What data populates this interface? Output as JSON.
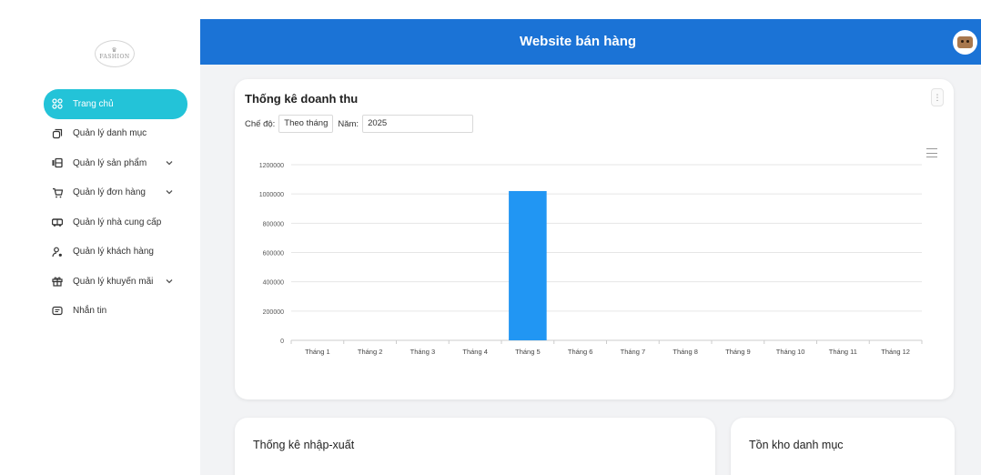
{
  "app": {
    "header_title": "Website bán hàng",
    "logo_text": "FASHION"
  },
  "sidebar": {
    "items": [
      {
        "label": "Trang chủ",
        "icon": "dashboard-icon",
        "active": true,
        "has_submenu": false
      },
      {
        "label": "Quản lý danh mục",
        "icon": "categories-icon",
        "active": false,
        "has_submenu": false
      },
      {
        "label": "Quản lý sản phẩm",
        "icon": "products-icon",
        "active": false,
        "has_submenu": true
      },
      {
        "label": "Quản lý đơn hàng",
        "icon": "cart-icon",
        "active": false,
        "has_submenu": true
      },
      {
        "label": "Quản lý nhà cung cấp",
        "icon": "truck-icon",
        "active": false,
        "has_submenu": false
      },
      {
        "label": "Quản lý khách hàng",
        "icon": "user-icon",
        "active": false,
        "has_submenu": false
      },
      {
        "label": "Quản lý khuyến mãi",
        "icon": "gift-icon",
        "active": false,
        "has_submenu": true
      },
      {
        "label": "Nhắn tin",
        "icon": "message-icon",
        "active": false,
        "has_submenu": false
      }
    ]
  },
  "revenue_card": {
    "title": "Thống kê doanh thu",
    "mode_label": "Chế độ:",
    "mode_value": "Theo tháng",
    "year_label": "Năm:",
    "year_value": "2025"
  },
  "io_card": {
    "title": "Thống kê nhập-xuất"
  },
  "stock_card": {
    "title": "Tồn kho danh mục"
  },
  "colors": {
    "header": "#1b73d6",
    "active_menu": "#23c3d8",
    "bar": "#2196f3"
  },
  "chart_data": {
    "type": "bar",
    "categories": [
      "Tháng 1",
      "Tháng 2",
      "Tháng 3",
      "Tháng 4",
      "Tháng 5",
      "Tháng 6",
      "Tháng 7",
      "Tháng 8",
      "Tháng 9",
      "Tháng 10",
      "Tháng 11",
      "Tháng 12"
    ],
    "series": [
      {
        "values": [
          0,
          0,
          0,
          0,
          1020000,
          0,
          0,
          0,
          0,
          0,
          0,
          0
        ]
      }
    ],
    "yticks": [
      0,
      200000,
      400000,
      600000,
      800000,
      1000000,
      1200000
    ],
    "ylim": [
      0,
      1200000
    ],
    "grid": true,
    "legend": "none"
  }
}
